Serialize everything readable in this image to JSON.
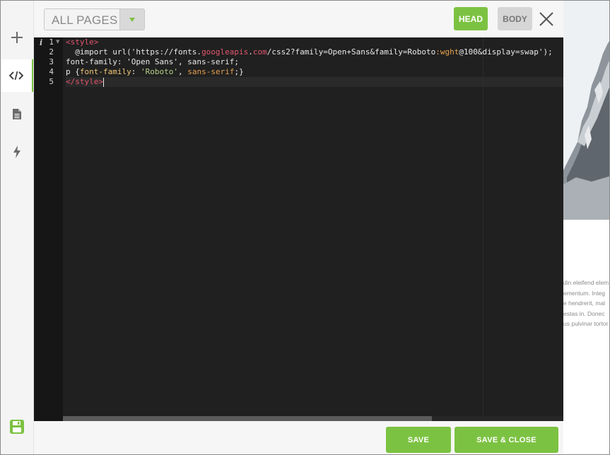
{
  "sidebar": {
    "items": [
      {
        "icon": "plus-icon",
        "label": "Add"
      },
      {
        "icon": "code-icon",
        "label": "Code",
        "active": true
      },
      {
        "icon": "document-icon",
        "label": "Page"
      },
      {
        "icon": "bolt-icon",
        "label": "Actions"
      },
      {
        "icon": "save-icon",
        "label": "Save"
      }
    ]
  },
  "toolbar": {
    "pages_select": "ALL PAGES",
    "head_label": "HEAD",
    "body_label": "BODY"
  },
  "editor": {
    "gutter": {
      "info": "i",
      "lines": [
        "1",
        "2",
        "3",
        "4",
        "5"
      ]
    },
    "code_lines": [
      {
        "parts": [
          {
            "t": "<style>",
            "c": "tag"
          }
        ]
      },
      {
        "parts": [
          {
            "t": "  @import url('https://fonts.",
            "c": "plain"
          },
          {
            "t": "googleapis",
            "c": "red"
          },
          {
            "t": ".",
            "c": "plain"
          },
          {
            "t": "com",
            "c": "red"
          },
          {
            "t": "/css2?family=Open+Sans&family=Roboto",
            "c": "plain"
          },
          {
            "t": ":wght",
            "c": "orange"
          },
          {
            "t": "@100&display=swap');",
            "c": "plain"
          }
        ]
      },
      {
        "parts": [
          {
            "t": "font-family: 'Open Sans', sans-serif;",
            "c": "plain"
          }
        ]
      },
      {
        "parts": [
          {
            "t": "p {",
            "c": "plain"
          },
          {
            "t": "font-family",
            "c": "prop"
          },
          {
            "t": ": ",
            "c": "plain"
          },
          {
            "t": "'Roboto'",
            "c": "strg"
          },
          {
            "t": ", ",
            "c": "plain"
          },
          {
            "t": "sans-serif",
            "c": "orange"
          },
          {
            "t": ";}",
            "c": "plain"
          }
        ]
      },
      {
        "parts": [
          {
            "t": "</style>",
            "c": "tag"
          }
        ],
        "cursor": true
      }
    ]
  },
  "preview": {
    "text_lines": [
      "din eleifend elem",
      "ementum. Integ",
      "e hendrerit, mal",
      "estas in. Donec",
      "us pulvinar tortor vitae"
    ]
  },
  "footer": {
    "save_label": "SAVE",
    "save_close_label": "SAVE & CLOSE"
  },
  "colors": {
    "accent": "#7cc242",
    "editor_bg": "#202020",
    "tag": "#e2566c"
  }
}
